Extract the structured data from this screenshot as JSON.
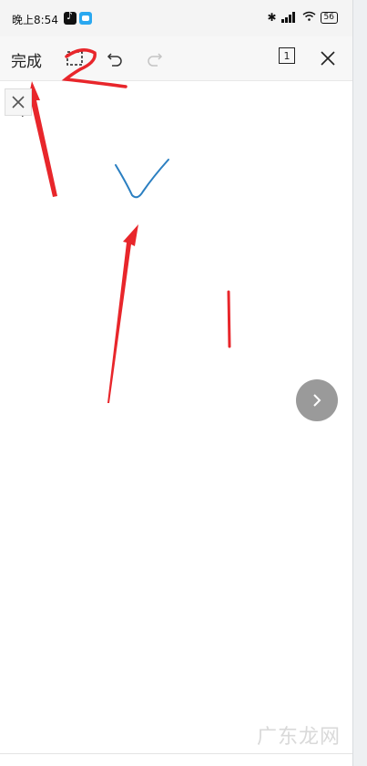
{
  "status_bar": {
    "time": "晚上8:54",
    "battery": "56",
    "network": "4G"
  },
  "toolbar": {
    "done_label": "完成",
    "page_number": "1"
  },
  "annotations": {
    "step_number": "2"
  },
  "watermark": {
    "text": "广东龙网"
  },
  "colors": {
    "annotation_red": "#e8262b",
    "drawing_blue": "#2b7fc1",
    "next_button_gray": "#9a9a9a"
  },
  "icons": [
    "tiktok-icon",
    "chat-icon",
    "bluetooth-icon",
    "signal-icon",
    "wifi-icon",
    "battery-icon",
    "crop-icon",
    "undo-icon",
    "redo-icon",
    "close-icon",
    "chevron-right-icon"
  ]
}
